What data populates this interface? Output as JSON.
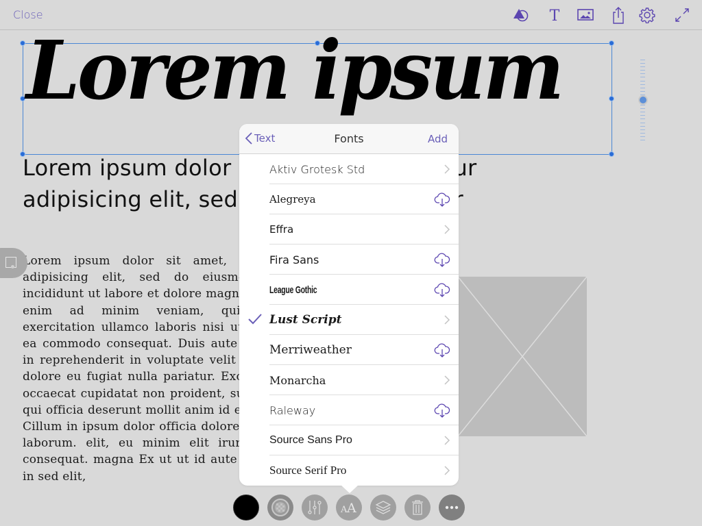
{
  "topbar": {
    "close_label": "Close",
    "icons": [
      "shapes-icon",
      "text-icon",
      "image-icon",
      "share-icon",
      "settings-icon",
      "expand-icon"
    ],
    "accent_color": "#5b45b0"
  },
  "canvas": {
    "title": "Lorem ipsum",
    "subtitle": "Lorem ipsum dolor sit amet, consectetur adipisicing elit, sed do eiusmod tempor",
    "body": "Lorem ipsum dolor sit amet, consectetur adipisicing elit, sed do eiusmod tempor incididunt ut labore et dolore magna aliqua. Ut enim ad minim veniam, quis nostrud exercitation ullamco laboris nisi ut aliquip ex ea commodo consequat. Duis aute irure dolor in reprehenderit in voluptate velit esse cillum dolore eu fugiat nulla pariatur. Excepteur sint occaecat cupidatat non proident, sunt in culpa qui officia deserunt mollit anim id est laborum. Cillum in ipsum dolor officia dolore ad veniam, laborum. elit, eu minim elit irure occaecat consequat. magna Ex ut ut id aute aliqua. non in sed elit,",
    "selection_color": "#2a6cd6",
    "slider_value": 0.5
  },
  "font_popover": {
    "back_label": "Text",
    "title": "Fonts",
    "add_label": "Add",
    "fonts": [
      {
        "name": "Aktiv Grotesk Std",
        "action": "chevron",
        "selected": false
      },
      {
        "name": "Alegreya",
        "action": "download",
        "selected": false
      },
      {
        "name": "Effra",
        "action": "chevron",
        "selected": false
      },
      {
        "name": "Fira Sans",
        "action": "download",
        "selected": false
      },
      {
        "name": "League Gothic",
        "action": "download",
        "selected": false
      },
      {
        "name": "Lust Script",
        "action": "chevron",
        "selected": true
      },
      {
        "name": "Merriweather",
        "action": "download",
        "selected": false
      },
      {
        "name": "Monarcha",
        "action": "chevron",
        "selected": false
      },
      {
        "name": "Raleway",
        "action": "download",
        "selected": false
      },
      {
        "name": "Source Sans Pro",
        "action": "chevron",
        "selected": false
      },
      {
        "name": "Source Serif Pro",
        "action": "chevron",
        "selected": false
      }
    ]
  },
  "bottom_toolbar": {
    "buttons": [
      "color-swatch",
      "fill-pattern",
      "adjustments",
      "font-style",
      "layers",
      "delete",
      "more"
    ],
    "active": "font-style"
  }
}
